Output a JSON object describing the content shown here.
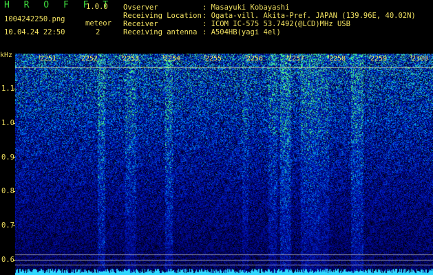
{
  "header": {
    "app_title": "H R O F F T",
    "version": "1.0.0",
    "filename": "1004242250.png",
    "datetime": "10.04.24 22:50",
    "meteor_label": "meteor",
    "meteor_count": "2",
    "info_labels": [
      "Ovserver",
      "Receiving Location",
      "Receiver",
      "Receiving antenna"
    ],
    "info_values": [
      ": Masayuki Kobayashi",
      ": Ogata-vill. Akita-Pref. JAPAN (139.96E, 40.02N)",
      ": ICOM IC-575 53.7492(@LCD)MHz USB",
      ": A504HB(yagi 4el)"
    ]
  },
  "axis": {
    "y_unit": "kHz",
    "y_ticks": [
      "1.1",
      "1.0",
      "0.9",
      "0.8",
      "0.7",
      "0.6"
    ],
    "x_ticks": [
      "2251",
      "2252",
      "2253",
      "2254",
      "2255",
      "2256",
      "2257",
      "2258",
      "2259",
      "2300"
    ]
  },
  "colors": {
    "background": "#000000",
    "text": "#f0e060",
    "title": "#3fdc3f",
    "noise_low": "#0a1a7a",
    "noise_high": "#3ad0ff",
    "meteor": "#40ff80"
  }
}
